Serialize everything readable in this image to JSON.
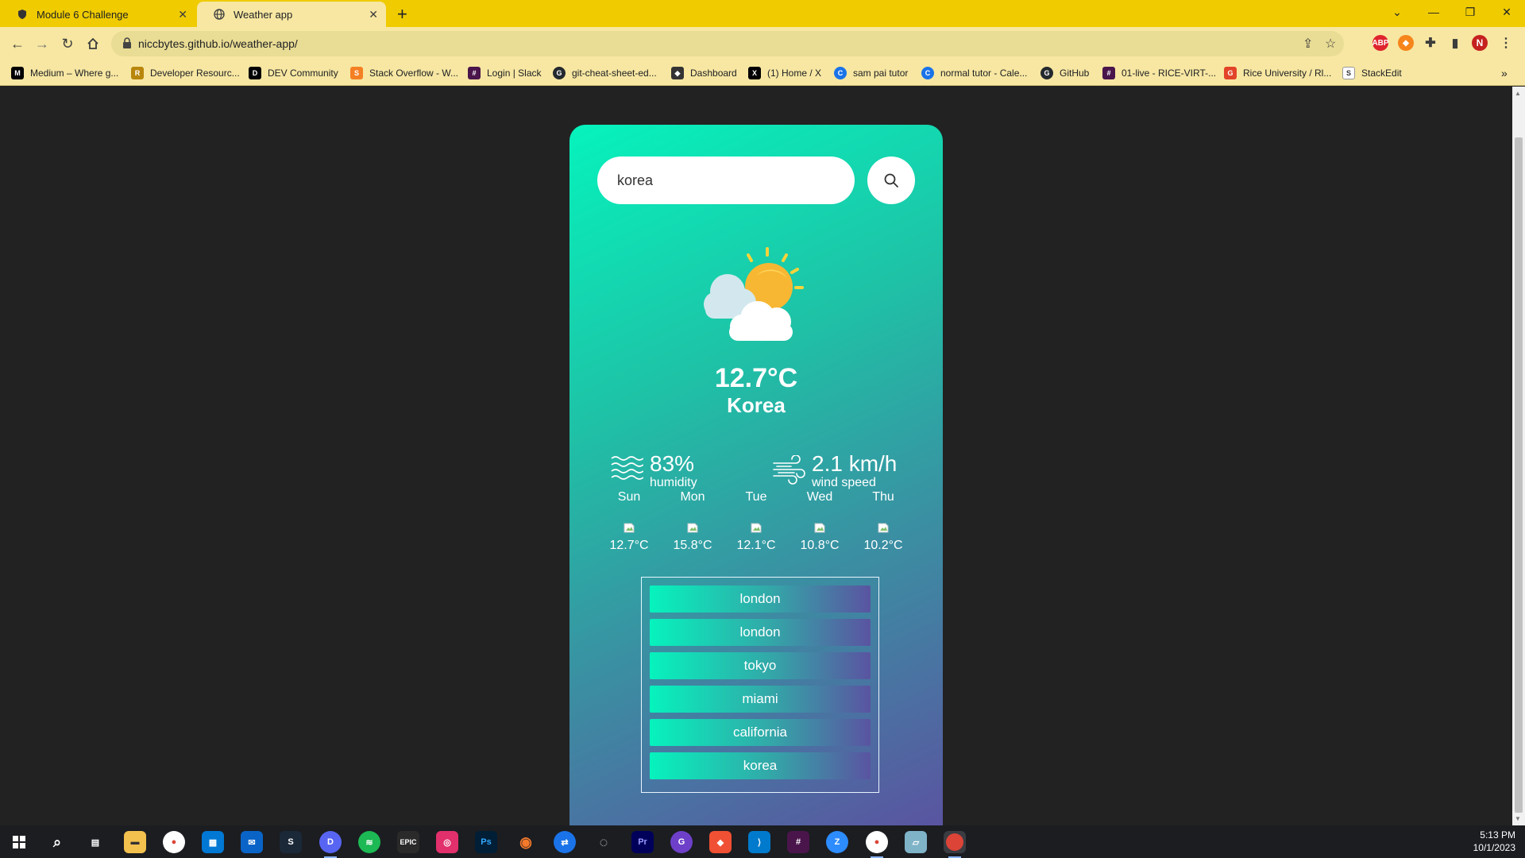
{
  "browser": {
    "tabs": [
      {
        "title": "Module 6 Challenge",
        "active": false
      },
      {
        "title": "Weather app",
        "active": true
      }
    ],
    "url": "niccbytes.github.io/weather-app/",
    "profile_initial": "N",
    "bookmarks": [
      "Medium – Where g...",
      "Developer Resourc...",
      "DEV Community",
      "Stack Overflow - W...",
      "Login | Slack",
      "git-cheat-sheet-ed...",
      "Dashboard",
      "(1) Home / X",
      "sam pai tutor",
      "normal tutor - Cale...",
      "GitHub",
      "01-live - RICE-VIRT-...",
      "Rice University / Rl...",
      "StackEdit"
    ]
  },
  "app": {
    "search": {
      "value": "korea"
    },
    "current": {
      "temp": "12.7°C",
      "city": "Korea",
      "humidity_value": "83%",
      "humidity_label": "humidity",
      "wind_value": "2.1 km/h",
      "wind_label": "wind speed",
      "icon": "partly-cloudy-icon"
    },
    "forecast": [
      {
        "day": "Sun",
        "temp": "12.7°C"
      },
      {
        "day": "Mon",
        "temp": "15.8°C"
      },
      {
        "day": "Tue",
        "temp": "12.1°C"
      },
      {
        "day": "Wed",
        "temp": "10.8°C"
      },
      {
        "day": "Thu",
        "temp": "10.2°C"
      }
    ],
    "history": [
      "london",
      "london",
      "tokyo",
      "miami",
      "california",
      "korea"
    ]
  },
  "taskbar": {
    "time": "5:13 PM",
    "date": "10/1/2023"
  },
  "colors": {
    "tabstrip": "#efcb00",
    "toolbar": "#f7e7a2",
    "page_bg": "#222222",
    "card_gradient_start": "#06f3bd",
    "card_gradient_end": "#5a54a1"
  }
}
